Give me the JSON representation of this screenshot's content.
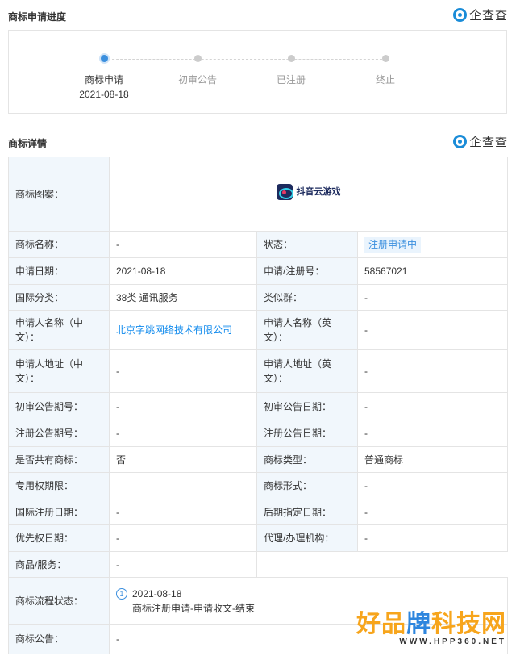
{
  "progress": {
    "title": "商标申请进度",
    "brand": "企查查",
    "steps": [
      {
        "label": "商标申请",
        "date": "2021-08-18",
        "active": true
      },
      {
        "label": "初审公告",
        "date": "",
        "active": false
      },
      {
        "label": "已注册",
        "date": "",
        "active": false
      },
      {
        "label": "终止",
        "date": "",
        "active": false
      }
    ]
  },
  "details": {
    "title": "商标详情",
    "brand": "企查查",
    "logo_label": "商标图案：",
    "logo_text": "抖音云游戏",
    "rows": {
      "name": {
        "k": "商标名称：",
        "v": "-"
      },
      "status": {
        "k": "状态：",
        "v": "注册申请中"
      },
      "apply_date": {
        "k": "申请日期：",
        "v": "2021-08-18"
      },
      "reg_no": {
        "k": "申请/注册号：",
        "v": "58567021"
      },
      "intl_class": {
        "k": "国际分类：",
        "v": "38类 通讯服务"
      },
      "similar_group": {
        "k": "类似群：",
        "v": "-"
      },
      "applicant_cn": {
        "k": "申请人名称（中文）：",
        "v": "北京字跳网络技术有限公司"
      },
      "applicant_en": {
        "k": "申请人名称（英文）：",
        "v": "-"
      },
      "address_cn": {
        "k": "申请人地址（中文）：",
        "v": "-"
      },
      "address_en": {
        "k": "申请人地址（英文）：",
        "v": "-"
      },
      "prelim_no": {
        "k": "初审公告期号：",
        "v": "-"
      },
      "prelim_date": {
        "k": "初审公告日期：",
        "v": "-"
      },
      "reg_pub_no": {
        "k": "注册公告期号：",
        "v": "-"
      },
      "reg_pub_date": {
        "k": "注册公告日期：",
        "v": "-"
      },
      "shared": {
        "k": "是否共有商标：",
        "v": "否"
      },
      "tm_type": {
        "k": "商标类型：",
        "v": "普通商标"
      },
      "exclusive_period": {
        "k": "专用权期限：",
        "v": ""
      },
      "tm_form": {
        "k": "商标形式：",
        "v": "-"
      },
      "intl_reg_date": {
        "k": "国际注册日期：",
        "v": "-"
      },
      "late_designation_date": {
        "k": "后期指定日期：",
        "v": "-"
      },
      "priority_date": {
        "k": "优先权日期：",
        "v": "-"
      },
      "agency": {
        "k": "代理/办理机构：",
        "v": "-"
      },
      "goods": {
        "k": "商品/服务：",
        "v": "-"
      },
      "flow": {
        "k": "商标流程状态：",
        "num": "1",
        "date": "2021-08-18",
        "desc": "商标注册申请-申请收文-结束"
      },
      "announcement": {
        "k": "商标公告：",
        "v": "-"
      }
    }
  },
  "watermark": {
    "title_part1": "好品",
    "title_part2": "牌",
    "title_part3": "科技网",
    "url": "WWW.HPP360.NET"
  },
  "colors": {
    "accent": "#3b8fde",
    "key_bg": "#f1f7fc",
    "link": "#128bed",
    "watermark_orange": "#f7a51c"
  }
}
